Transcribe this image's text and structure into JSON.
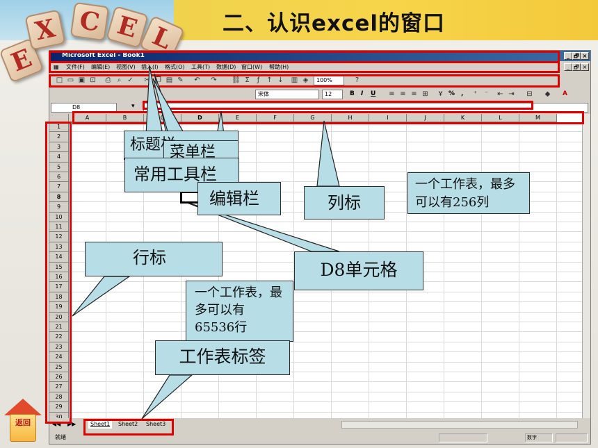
{
  "slide": {
    "title": "二、认识excel的窗口",
    "logo_letters": [
      "E",
      "X",
      "C",
      "E",
      "L"
    ],
    "home_button": "返回"
  },
  "excel": {
    "title_bar": "Microsoft Excel - Book1",
    "window_controls": [
      "_",
      "🗗",
      "×"
    ],
    "menus": [
      "文件(F)",
      "编辑(E)",
      "视图(V)",
      "插入(I)",
      "格式(O)",
      "工具(T)",
      "数据(D)",
      "窗口(W)",
      "帮助(H)"
    ],
    "zoom": "100%",
    "font_name": "宋体",
    "font_size": "12",
    "name_box": "D8",
    "columns": [
      "A",
      "B",
      "C",
      "D",
      "E",
      "F",
      "G",
      "H",
      "I",
      "J",
      "K",
      "L",
      "M"
    ],
    "rows": [
      "1",
      "2",
      "3",
      "4",
      "5",
      "6",
      "7",
      "8",
      "9",
      "10",
      "11",
      "12",
      "13",
      "14",
      "15",
      "16",
      "17",
      "18",
      "19",
      "20",
      "21",
      "22",
      "23",
      "24",
      "25",
      "26",
      "27",
      "28",
      "29",
      "30"
    ],
    "active_row": "8",
    "sheets": [
      "Sheet1",
      "Sheet2",
      "Sheet3"
    ],
    "status": "就绪",
    "status_num": "数字"
  },
  "callouts": {
    "title_bar_label": "标题栏",
    "menu_bar_label": "菜单栏",
    "standard_toolbar": "常用工具栏",
    "formula_bar": "编辑栏",
    "column_header": "列标",
    "max_columns": "一个工作表，最多可以有256列",
    "row_header": "行标",
    "cell_d8": "D8单元格",
    "max_rows": "一个工作表，最多可以有65536行",
    "sheet_tabs": "工作表标签"
  },
  "colors": {
    "highlight": "#e00000",
    "callout_fill": "#b7dde6",
    "title_band": "#f7d54a"
  }
}
